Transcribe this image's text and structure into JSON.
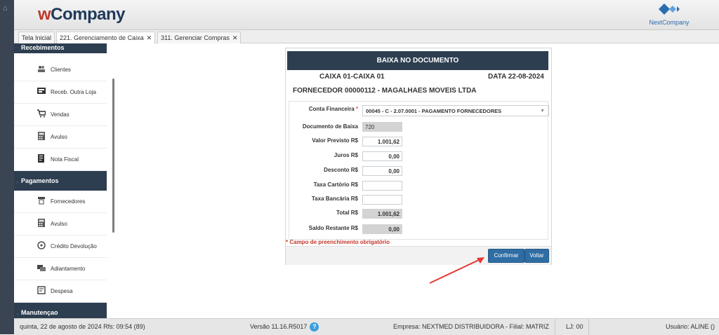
{
  "header": {
    "logo_w": "w",
    "logo_company": "Company",
    "partner_logo": "NextCompany"
  },
  "tabs": [
    {
      "label": "Tela Inicial"
    },
    {
      "label": "221. Gerenciamento de Caixa",
      "close": "✕"
    },
    {
      "label": "311. Gerenciar Compras",
      "close": "✕"
    }
  ],
  "sidebar": {
    "recebimentos": {
      "title": "Recebimentos",
      "items": [
        {
          "label": "Clientes",
          "icon": "clients-icon"
        },
        {
          "label": "Receb. Outra Loja",
          "icon": "store-receipt-icon"
        },
        {
          "label": "Vendas",
          "icon": "cart-icon"
        },
        {
          "label": "Avulso",
          "icon": "calculator-icon"
        },
        {
          "label": "Nota Fiscal",
          "icon": "invoice-icon"
        }
      ]
    },
    "pagamentos": {
      "title": "Pagamentos",
      "items": [
        {
          "label": "Fornecedores",
          "icon": "supplier-icon"
        },
        {
          "label": "Avulso",
          "icon": "calculator-icon"
        },
        {
          "label": "Crédito Devolução",
          "icon": "refund-icon"
        },
        {
          "label": "Adiantamento",
          "icon": "advance-icon"
        },
        {
          "label": "Despesa",
          "icon": "expense-icon"
        }
      ]
    },
    "manutencao": {
      "title": "Manutençao"
    }
  },
  "form": {
    "title": "BAIXA NO DOCUMENTO",
    "caixa": "CAIXA  01-CAIXA 01",
    "data": "DATA  22-08-2024",
    "fornecedor": "FORNECEDOR  00000112 - MAGALHAES MOVEIS LTDA",
    "conta_label": "Conta Financeira",
    "conta_required": "*",
    "conta_value": "00045 - C - 2.07.0001 - PAGAMENTO FORNECEDORES",
    "fields": {
      "documento_label": "Documento de Baixa",
      "documento_value": "720",
      "valor_previsto_label": "Valor Previsto R$",
      "valor_previsto_value": "1.001,62",
      "juros_label": "Juros R$",
      "juros_value": "0,00",
      "desconto_label": "Desconto R$",
      "desconto_value": "0,00",
      "taxa_cartorio_label": "Taxa Cartório R$",
      "taxa_cartorio_value": "",
      "taxa_bancaria_label": "Taxa Bancária R$",
      "taxa_bancaria_value": "",
      "total_label": "Total R$",
      "total_value": "1.001,62",
      "saldo_label": "Saldo Restante R$",
      "saldo_value": "0,00"
    },
    "required_note": "* Campo de preenchimento obrigatório",
    "confirm_label": "Confirmar",
    "back_label": "Voltar"
  },
  "status": {
    "datetime": "quinta, 22 de agosto de 2024  Rfs: 09:54 (89)",
    "version": "Versão 11.16.R5017",
    "help": "?",
    "empresa": "Empresa: NEXTMED DISTRIBUIDORA - Filial: MATRIZ",
    "loja": "LJ: 00",
    "usuario": "Usuário: ALINE ()"
  },
  "colors": {
    "accent": "#2d3e50",
    "button": "#2f6da3",
    "arrow": "#e53935"
  }
}
